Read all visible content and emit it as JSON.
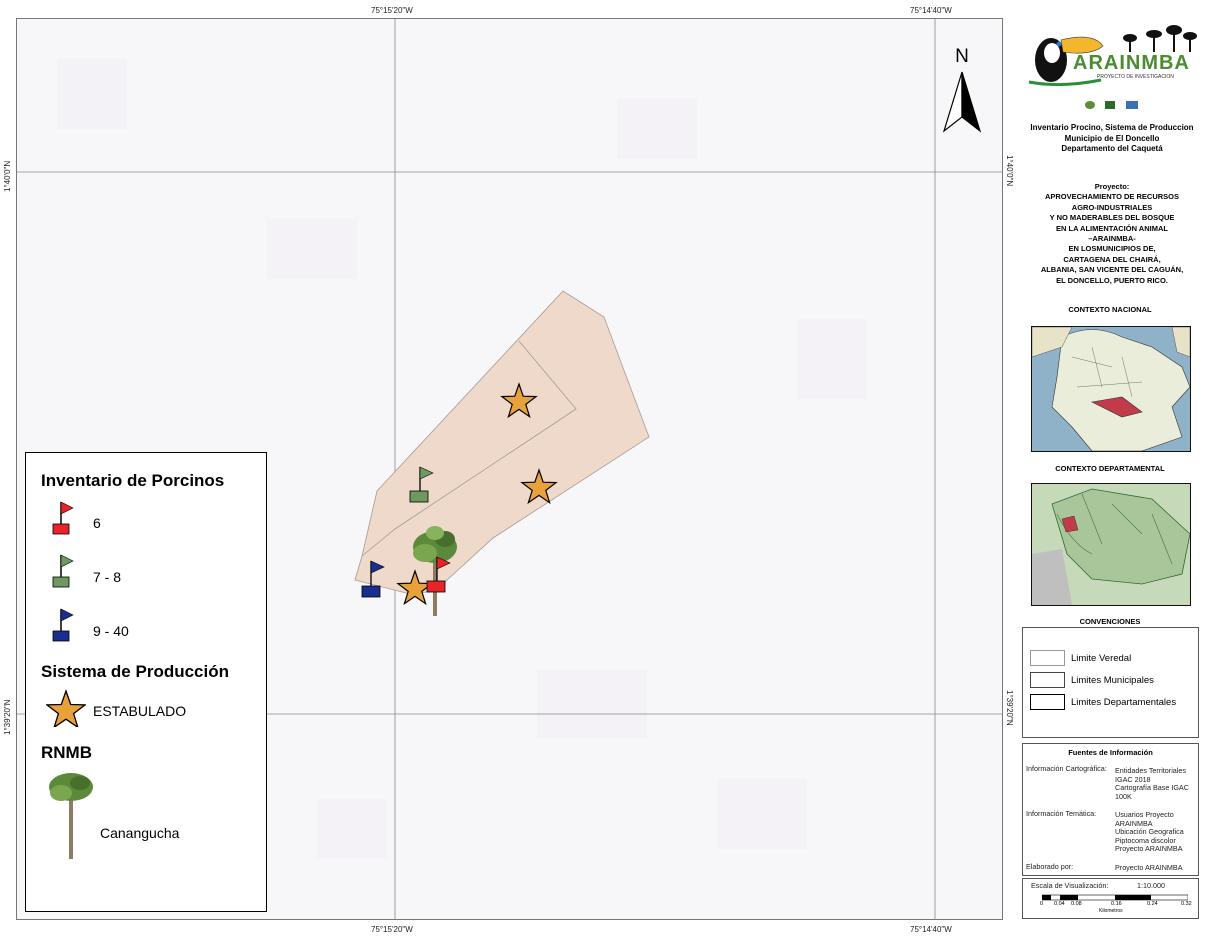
{
  "coords": {
    "top_lon_1": "75°15'20\"W",
    "top_lon_2": "75°14'40\"W",
    "bottom_lon_1": "75°15'20\"W",
    "bottom_lon_2": "75°14'40\"W",
    "left_lat_1": "1°40'0\"N",
    "left_lat_2": "1°39'20\"N",
    "right_lat_1": "1°40'0\"N",
    "right_lat_2": "1°39'20\"N"
  },
  "north_label": "N",
  "legend": {
    "title_inventario": "Inventario de Porcinos",
    "class_1": "6",
    "class_2": "7 - 8",
    "class_3": "9 - 40",
    "title_sistema": "Sistema de Producción",
    "sistema_1": "ESTABULADO",
    "title_rnmb": "RNMB",
    "rnmb_1": "Canangucha"
  },
  "colors": {
    "red_flag": "#e8242a",
    "green_flag": "#6e9a5f",
    "blue_flag": "#1a2e8f",
    "star": "#e9a13b",
    "polygon": "#efd9cb"
  },
  "logo": {
    "name": "ARAINMBA",
    "tagline": "PROYECTO DE INVESTIGACION"
  },
  "sidebar": {
    "title_line1": "Inventario Procino, Sistema de Produccion",
    "title_line2": "Municipio de El Doncello",
    "title_line3": "Departamento del Caquetá",
    "project_label": "Proyecto:",
    "project_lines": [
      "APROVECHAMIENTO DE RECURSOS",
      "AGRO-INDUSTRIALES",
      "Y NO MADERABLES DEL BOSQUE",
      "EN LA ALIMENTACIÓN ANIMAL",
      "–ARAINMBA-",
      "EN LOSMUNICIPIOS DE,",
      "CARTAGENA DEL CHAIRÁ,",
      "ALBANIA, SAN VICENTE DEL CAGUÁN,",
      "EL DONCELLO, PUERTO RICO."
    ],
    "contexto_nacional": "CONTEXTO NACIONAL",
    "contexto_departamental": "CONTEXTO DEPARTAMENTAL",
    "convenciones": "CONVENCIONES",
    "conv_items": [
      "Limite Veredal",
      "Limites Municipales",
      "Limites Departamentales"
    ],
    "fuentes_title": "Fuentes de Información",
    "info_carto_label": "Información Cartográfica:",
    "info_carto_value": [
      "Entidades Territoriales",
      "IGAC 2018",
      "Cartografía Base IGAC",
      "100K"
    ],
    "info_tema_label": "Información Temática:",
    "info_tema_value": [
      "Usuarios Proyecto",
      "ARAINMBA",
      "Ubicación Geografica",
      "Piptocoma discolor",
      "Proyecto ARAINMBA"
    ],
    "elaborado_label": "Elaborado por:",
    "elaborado_value": "Proyecto ARAINMBA",
    "escala_label": "Escala de Visualización:",
    "escala_value": "1:10.000",
    "scale_ticks": [
      "0",
      "0.04",
      "0.08",
      "0.16",
      "0.24",
      "0.32"
    ],
    "scale_unit": "Kilometros"
  }
}
